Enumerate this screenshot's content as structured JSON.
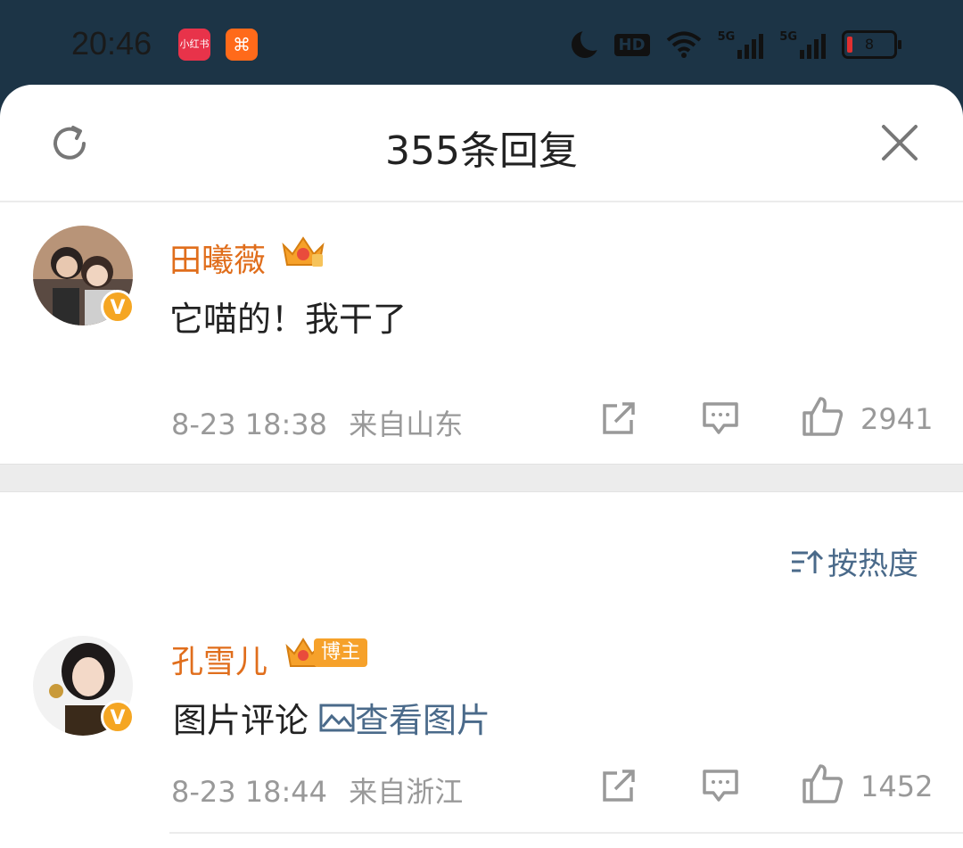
{
  "status": {
    "time": "20:46",
    "apps": [
      "小红书",
      "⌘"
    ],
    "network1": "5G",
    "network2": "5G",
    "hd": "HD",
    "battery": "8"
  },
  "header": {
    "title": "355条回复"
  },
  "comments": [
    {
      "user": "田曦薇",
      "text": "它喵的！我干了",
      "date": "8-23 18:38",
      "location": "来自山东",
      "likes": "2941"
    },
    {
      "user": "孔雪儿",
      "tag": "博主",
      "text": "图片评论",
      "image_link": "查看图片",
      "date": "8-23 18:44",
      "location": "来自浙江",
      "likes": "1452"
    }
  ],
  "sort": {
    "label": "按热度"
  },
  "colors": {
    "username": "#e06e1c",
    "link": "#4a6a8a",
    "meta": "#999999",
    "statusbar": "#1c3446"
  }
}
